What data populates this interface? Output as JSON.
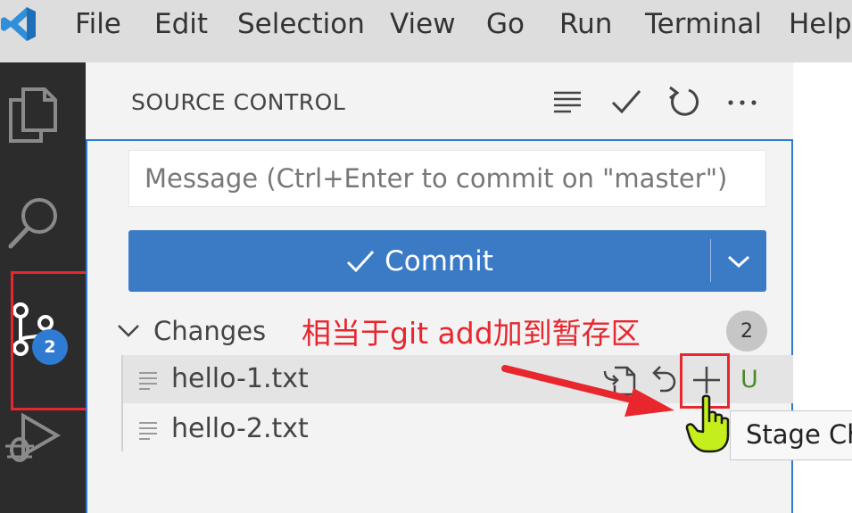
{
  "menubar": {
    "logo_icon": "vscode-logo-icon",
    "items": [
      "File",
      "Edit",
      "Selection",
      "View",
      "Go",
      "Run",
      "Terminal",
      "Help"
    ]
  },
  "activitybar": {
    "icons": [
      "files-icon",
      "search-icon",
      "source-control-icon",
      "run-debug-icon"
    ],
    "source_control_badge": "2"
  },
  "sidebar": {
    "title": "SOURCE CONTROL",
    "toolbar_icons": [
      "view-as-tree-icon",
      "commit-check-icon",
      "refresh-icon",
      "more-actions-icon"
    ],
    "commit_message": {
      "value": "",
      "placeholder": "Message (Ctrl+Enter to commit on \"master\")"
    },
    "commit_button": {
      "label": "Commit",
      "icon": "check-icon",
      "dropdown_icon": "chevron-down-icon"
    },
    "changes": {
      "label": "Changes",
      "count": "2",
      "files": [
        {
          "name": "hello-1.txt",
          "status": "U",
          "actions": [
            "open-file-icon",
            "discard-changes-icon",
            "stage-changes-icon"
          ]
        },
        {
          "name": "hello-2.txt",
          "status": "",
          "actions": []
        }
      ]
    }
  },
  "tooltip": {
    "text": "Stage Ch"
  },
  "annotation": {
    "text": "相当于git add加到暂存区",
    "color": "#e8262e"
  },
  "colors": {
    "accent": "#3b7bc6",
    "badge": "#2f7bd1",
    "annotation_red": "#e8262e",
    "untracked_green": "#4a8a2b"
  }
}
